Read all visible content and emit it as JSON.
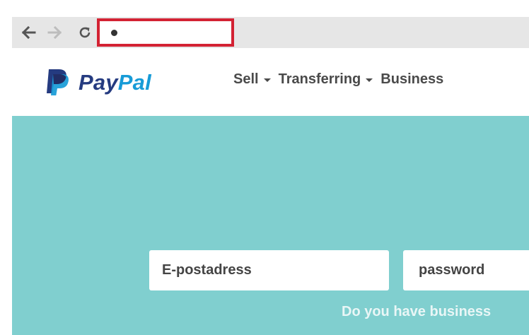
{
  "browser": {
    "back_icon": "back-arrow-icon",
    "forward_icon": "forward-arrow-icon",
    "reload_icon": "reload-icon",
    "address_highlight_color": "#d32233"
  },
  "header": {
    "logo": {
      "part1": "Pay",
      "part2": "Pal",
      "colors": {
        "dark": "#253b80",
        "light": "#179bd7"
      }
    },
    "nav": [
      {
        "label": "Sell",
        "has_dropdown": true
      },
      {
        "label": "Transferring",
        "has_dropdown": true
      },
      {
        "label": "Business",
        "has_dropdown": false
      }
    ]
  },
  "hero": {
    "background": "#80cfcf",
    "email_placeholder": "E-postadress",
    "password_placeholder": "password",
    "business_link": "Do you have business"
  }
}
